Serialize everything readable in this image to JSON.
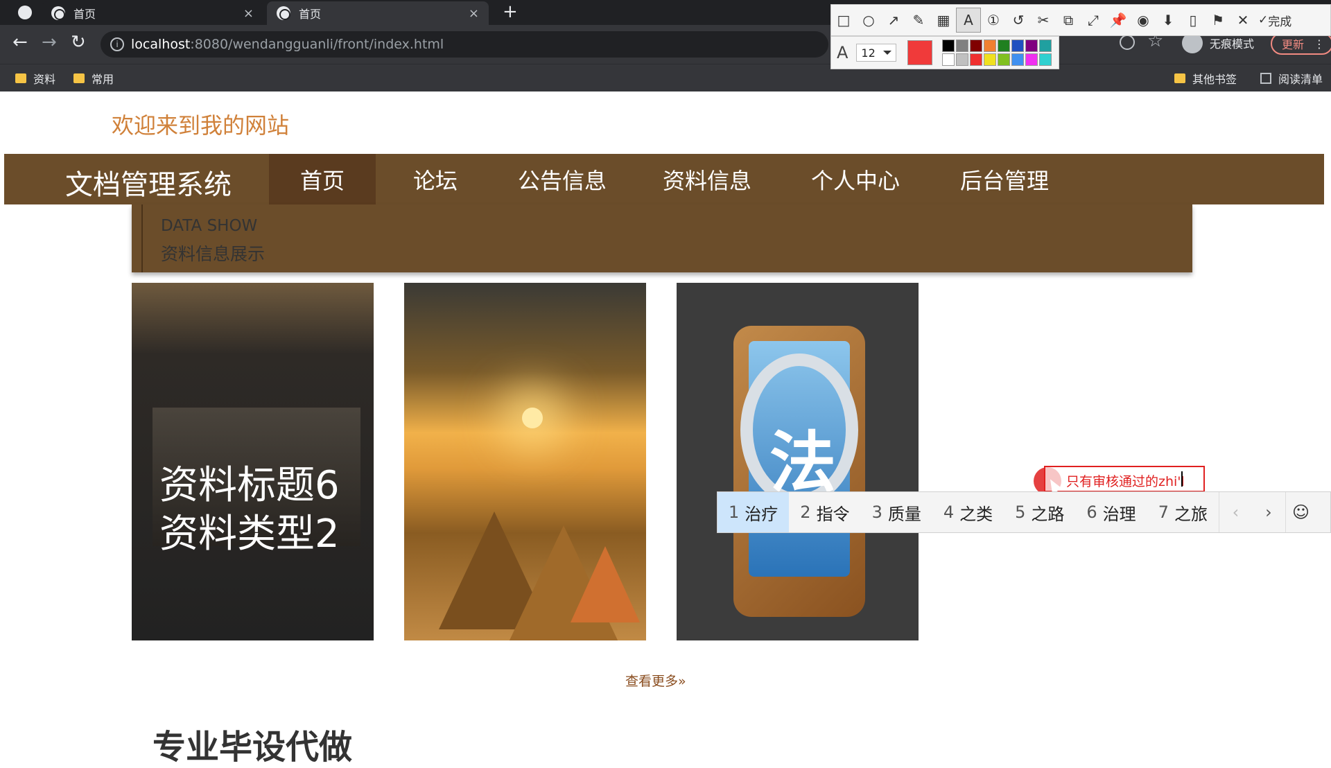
{
  "browser": {
    "tabs": [
      {
        "title": "首页",
        "close": "×"
      },
      {
        "title": "首页",
        "close": "×"
      }
    ],
    "new_tab": "+",
    "url_host": "localhost",
    "url_path": ":8080/wendangguanli/front/index.html",
    "nav": {
      "back": "←",
      "forward": "→",
      "reload": "↻"
    },
    "star": "☆",
    "incognito_label": "无痕模式",
    "update_label": "更新",
    "menu": "⋮",
    "bookmarks": [
      {
        "label": "资料"
      },
      {
        "label": "常用"
      }
    ],
    "other_bookmarks": "其他书签",
    "reading_list": "阅读清单"
  },
  "screenshot_tool": {
    "tools": [
      "□",
      "○",
      "↗",
      "✎",
      "▦",
      "A",
      "①",
      "↺",
      "✂",
      "⧉",
      "⤢",
      "📌",
      "◉",
      "⬇",
      "▯",
      "⚑",
      "✕"
    ],
    "selected_tool_index": 5,
    "done_check": "✓",
    "done_label": "完成",
    "font_icon": "A",
    "font_size": "12",
    "current_color": "#f03a3a",
    "palette": [
      "#000000",
      "#808080",
      "#800000",
      "#f08030",
      "#208020",
      "#2050c0",
      "#800080",
      "#20a0a0",
      "#ffffff",
      "#c0c0c0",
      "#f03030",
      "#f0e020",
      "#80c020",
      "#4090f0",
      "#f030f0",
      "#30d0d0"
    ]
  },
  "site": {
    "welcome": "欢迎来到我的网站",
    "logo": "文档管理系统",
    "nav": [
      {
        "label": "首页",
        "active": true
      },
      {
        "label": "论坛",
        "active": false
      },
      {
        "label": "公告信息",
        "active": false
      },
      {
        "label": "资料信息",
        "active": false
      },
      {
        "label": "个人中心",
        "active": false
      },
      {
        "label": "后台管理",
        "active": false
      }
    ],
    "section_en": "DATA SHOW",
    "section_zh": "资料信息展示",
    "cards": [
      {
        "line1": "资料标题6",
        "line2": "资料类型2"
      }
    ],
    "card3_char": "法",
    "more_link": "查看更多",
    "more_icon": "»",
    "next_heading": "专业毕设代做"
  },
  "annotation": {
    "text": "只有审核通过的zhi'l"
  },
  "ime": {
    "candidates": [
      {
        "num": "1",
        "word": "治疗"
      },
      {
        "num": "2",
        "word": "指令"
      },
      {
        "num": "3",
        "word": "质量"
      },
      {
        "num": "4",
        "word": "之类"
      },
      {
        "num": "5",
        "word": "之路"
      },
      {
        "num": "6",
        "word": "治理"
      },
      {
        "num": "7",
        "word": "之旅"
      }
    ],
    "selected_index": 0,
    "prev": "‹",
    "next": "›",
    "emoji": "☺"
  }
}
